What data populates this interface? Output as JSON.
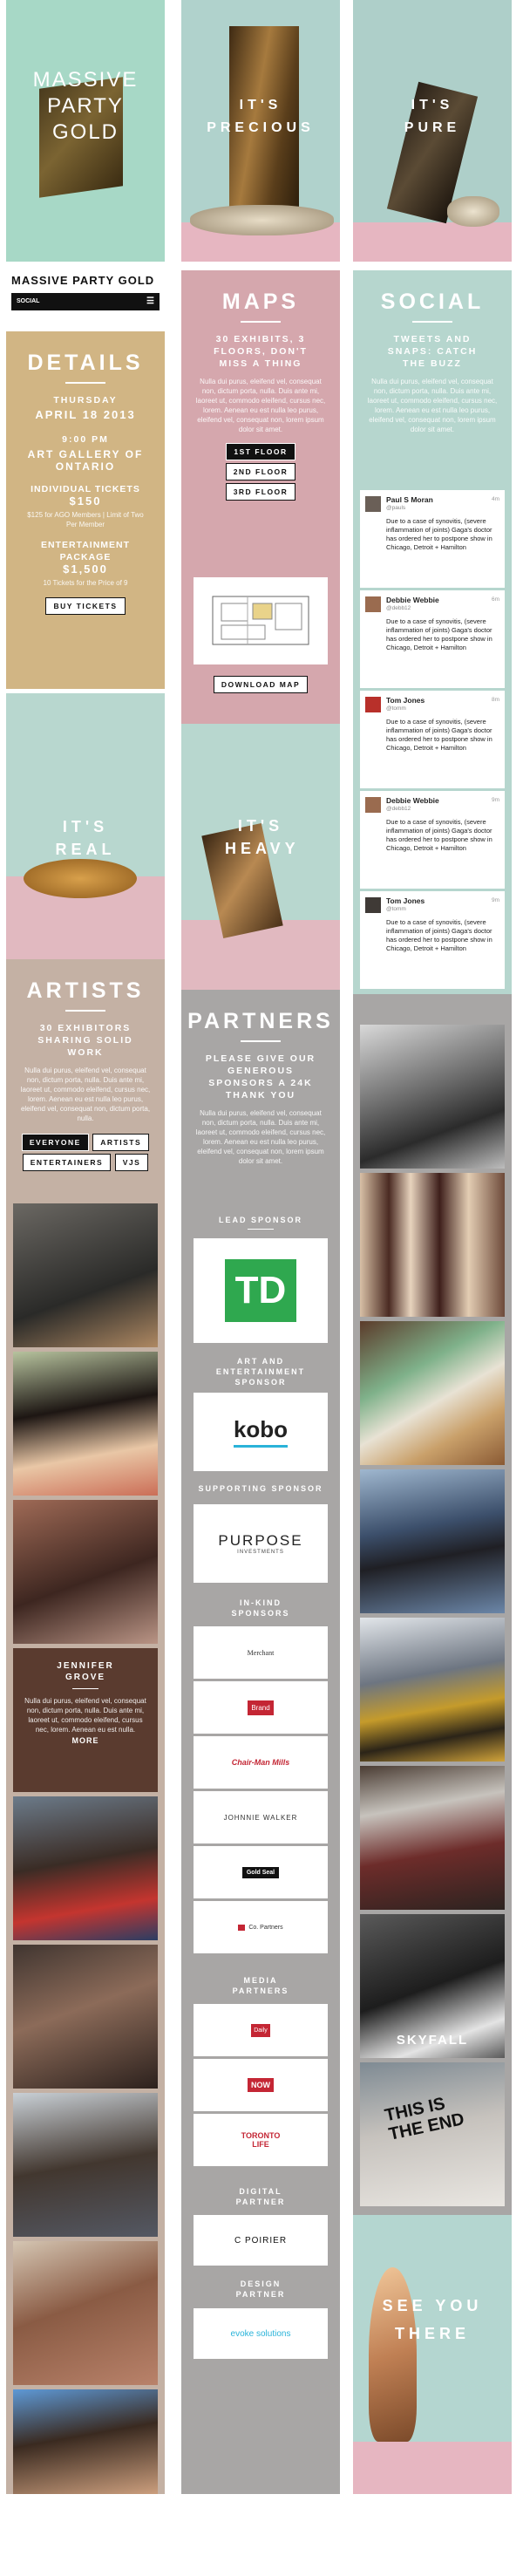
{
  "col1": {
    "hero_lines": [
      "Massive",
      "Party",
      "Gold"
    ],
    "brand": "Massive Party Gold",
    "menu_label": "Social",
    "details": {
      "heading": "Details",
      "day": "Thursday",
      "date": "April 18 2013",
      "time": "9:00 PM",
      "venue": "Art Gallery of Ontario",
      "ind_label": "Individual Tickets",
      "ind_price": "$150",
      "ind_note": "$125 for AGO Members | Limit of Two Per Member",
      "ent_label": "Entertainment Package",
      "ent_price": "$1,500",
      "ent_note": "10 Tickets for the Price of 9",
      "buy": "Buy Tickets"
    },
    "real": "It's Real",
    "artists": {
      "heading": "Artists",
      "sub": "30 Exhibitors Sharing Solid Work",
      "lorem": "Nulla dui purus, eleifend vel, consequat non, dictum porta, nulla. Duis ante mi, laoreet ut, commodo eleifend, cursus nec, lorem. Aenean eu est nulla leo purus, eleifend vel, consequat non, dictum porta, nulla.",
      "filters": [
        "Everyone",
        "Artists",
        "Entertainers",
        "VJs"
      ],
      "overlay_name": "Jennifer Grove",
      "overlay_text": "Nulla dui purus, eleifend vel, consequat non, dictum porta, nulla. Duis ante mi, laoreet ut, commodo eleifend, cursus nec, lorem. Aenean eu est nulla.",
      "more": "More"
    }
  },
  "col2": {
    "precious": "It's Precious",
    "maps": {
      "heading": "Maps",
      "sub": "30 Exhibits, 3 Floors, Don't Miss a Thing",
      "lorem": "Nulla dui purus, eleifend vel, consequat non, dictum porta, nulla. Duis ante mi, laoreet ut, commodo eleifend, cursus nec, lorem. Aenean eu est nulla leo purus, eleifend vel, consequat non, lorem ipsum dolor sit amet.",
      "floors": [
        "1st Floor",
        "2nd Floor",
        "3rd Floor"
      ],
      "download": "Download Map"
    },
    "heavy": "It's Heavy",
    "partners": {
      "heading": "Partners",
      "sub": "Please give our generous sponsors a 24K thank you",
      "lorem": "Nulla dui purus, eleifend vel, consequat non, dictum porta, nulla. Duis ante mi, laoreet ut, commodo eleifend, cursus nec, lorem. Aenean eu est nulla leo purus, eleifend vel, consequat non, lorem ipsum dolor sit amet.",
      "lead_label": "Lead Sponsor",
      "lead": "TD",
      "art_label": "Art and Entertainment Sponsor",
      "art": "kobo",
      "supp_label": "Supporting Sponsor",
      "supp": "PURPOSE",
      "supp_small": "INVESTMENTS",
      "inkind_label": "In-Kind Sponsors",
      "inkind": [
        "Merchant",
        "Brand",
        "Chair-Man Mills",
        "Johnnie Walker",
        "Gold Seal",
        "Co. Partners"
      ],
      "media_label": "Media Partners",
      "media": [
        "Daily",
        "NOW",
        "TORONTO LIFE"
      ],
      "digital_label": "Digital Partner",
      "digital": "C POIRIER",
      "design_label": "Design Partner",
      "design": "evoke solutions"
    }
  },
  "col3": {
    "pure": "It's Pure",
    "social": {
      "heading": "Social",
      "sub": "Tweets and Snaps: Catch the Buzz",
      "lorem": "Nulla dui purus, eleifend vel, consequat non, dictum porta, nulla. Duis ante mi, laoreet ut, commodo eleifend, cursus nec, lorem. Aenean eu est nulla leo purus, eleifend vel, consequat non, lorem ipsum dolor sit amet."
    },
    "tweets": [
      {
        "name": "Paul S Moran",
        "handle": "@pauls",
        "time": "4m",
        "text": "Due to a case of synovitis, (severe inflammation of joints) Gaga's doctor has ordered her to postpone show in Chicago, Detroit + Hamilton"
      },
      {
        "name": "Debbie Webbie",
        "handle": "@debb12",
        "time": "6m",
        "text": "Due to a case of synovitis, (severe inflammation of joints) Gaga's doctor has ordered her to postpone show in Chicago, Detroit + Hamilton"
      },
      {
        "name": "Tom Jones",
        "handle": "@tomm",
        "time": "8m",
        "text": "Due to a case of synovitis, (severe inflammation of joints) Gaga's doctor has ordered her to postpone show in Chicago, Detroit + Hamilton"
      },
      {
        "name": "Debbie Webbie",
        "handle": "@debb12",
        "time": "9m",
        "text": "Due to a case of synovitis, (severe inflammation of joints) Gaga's doctor has ordered her to postpone show in Chicago, Detroit + Hamilton"
      },
      {
        "name": "Tom Jones",
        "handle": "@tomm",
        "time": "9m",
        "text": "Due to a case of synovitis, (severe inflammation of joints) Gaga's doctor has ordered her to postpone show in Chicago, Detroit + Hamilton"
      }
    ],
    "skyfall": "Skyfall",
    "sign": "This is the End",
    "see": "See You There"
  }
}
